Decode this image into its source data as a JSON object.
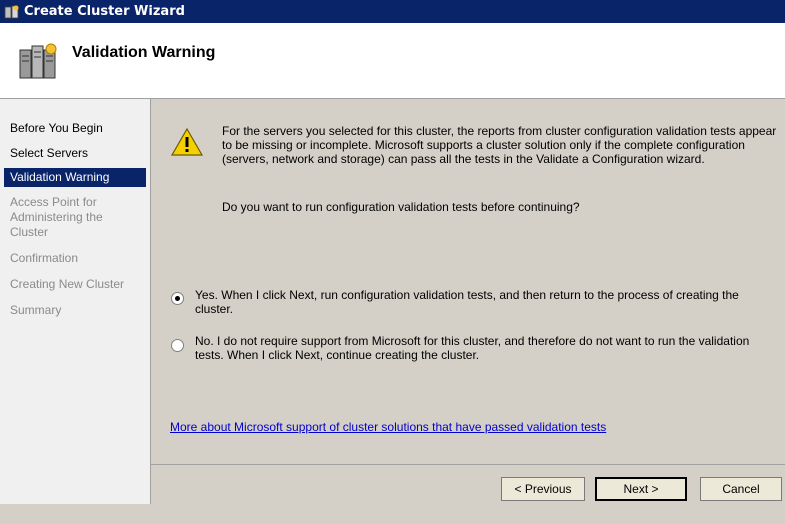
{
  "window": {
    "title": "Create Cluster Wizard"
  },
  "header": {
    "title": "Validation Warning"
  },
  "sidebar": {
    "items": [
      {
        "label": "Before You Begin",
        "state": "normal"
      },
      {
        "label": "Select Servers",
        "state": "normal"
      },
      {
        "label": "Validation Warning",
        "state": "active"
      },
      {
        "label": "Access Point for Administering the Cluster",
        "state": "disabled"
      },
      {
        "label": "Confirmation",
        "state": "disabled"
      },
      {
        "label": "Creating New Cluster",
        "state": "disabled"
      },
      {
        "label": "Summary",
        "state": "disabled"
      }
    ]
  },
  "content": {
    "warning_text": "For the servers you selected for this cluster, the reports from cluster configuration validation tests appear to be missing or incomplete.  Microsoft supports a cluster solution only if the complete configuration (servers, network and storage) can pass all the tests in the Validate a Configuration wizard.",
    "question": "Do you want to run configuration validation tests before continuing?",
    "option_yes": "Yes.  When I click Next, run configuration validation tests, and then return to the process of creating the cluster.",
    "option_no": "No.  I do not require support from Microsoft for this cluster, and therefore do not want to run the validation tests.  When I click Next, continue creating the cluster.",
    "selected_option": "yes",
    "link": "More about Microsoft support of cluster solutions that have passed validation tests"
  },
  "buttons": {
    "previous": "< Previous",
    "next": "Next >",
    "cancel": "Cancel"
  },
  "icons": {
    "title": "cluster-wizard-icon",
    "header": "server-cluster-icon",
    "warning": "warning-icon"
  },
  "colors": {
    "titlebar": "#0a246a",
    "active_item": "#0a246a",
    "panel": "#d4d0c8",
    "link": "#0000cc"
  }
}
